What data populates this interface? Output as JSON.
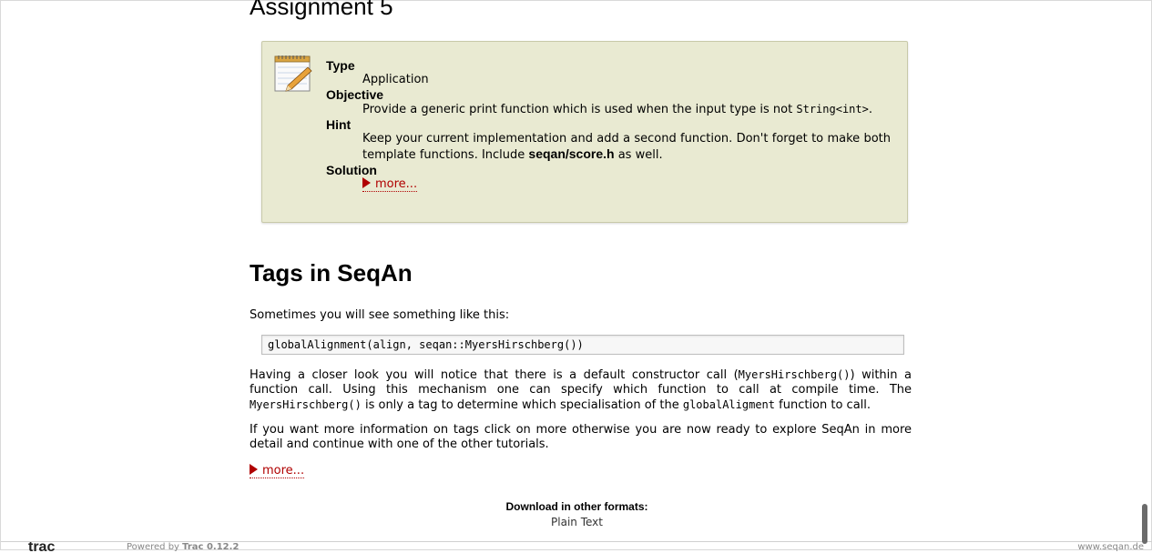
{
  "assignment": {
    "heading": "Assignment 5",
    "type_label": "Type",
    "type_value": "Application",
    "objective_label": "Objective",
    "objective_text": "Provide a generic print function which is used when the input type is not",
    "objective_code": "String<int>",
    "objective_end": ".",
    "hint_label": "Hint",
    "hint_text": "Keep your current implementation and add a second function. Don't forget to make both template functions. Include",
    "hint_bold": "seqan/score.h",
    "hint_end": "as well.",
    "solution_label": "Solution",
    "more_label": "more..."
  },
  "tags": {
    "heading": "Tags in SeqAn",
    "intro": "Sometimes you will see something like this:",
    "code": "globalAlignment(align, seqan::MyersHirschberg())",
    "p1_a": "Having a closer look you will notice that there is a default constructor call (",
    "p1_code1": "MyersHirschberg()",
    "p1_b": ") within a function call. Using this mechanism one can specify which function to call at compile time. The",
    "p1_code2": "MyersHirschberg()",
    "p1_c": "is only a tag to determine which specialisation of the",
    "p1_code3": "globalAligment",
    "p1_d": "function to call.",
    "p2": "If you want more information on tags click on more otherwise you are now ready to explore SeqAn in more detail and continue with one of the other tutorials.",
    "more_label": "more..."
  },
  "downloads": {
    "label": "Download in other formats:",
    "plain_text": "Plain Text"
  },
  "footer": {
    "logo_text": "trac",
    "powered_by": "Powered by",
    "trac_version": "Trac 0.12.2",
    "site": "www.seqan.de"
  },
  "colors": {
    "box_bg": "#e9ead2",
    "link": "#b00000"
  }
}
